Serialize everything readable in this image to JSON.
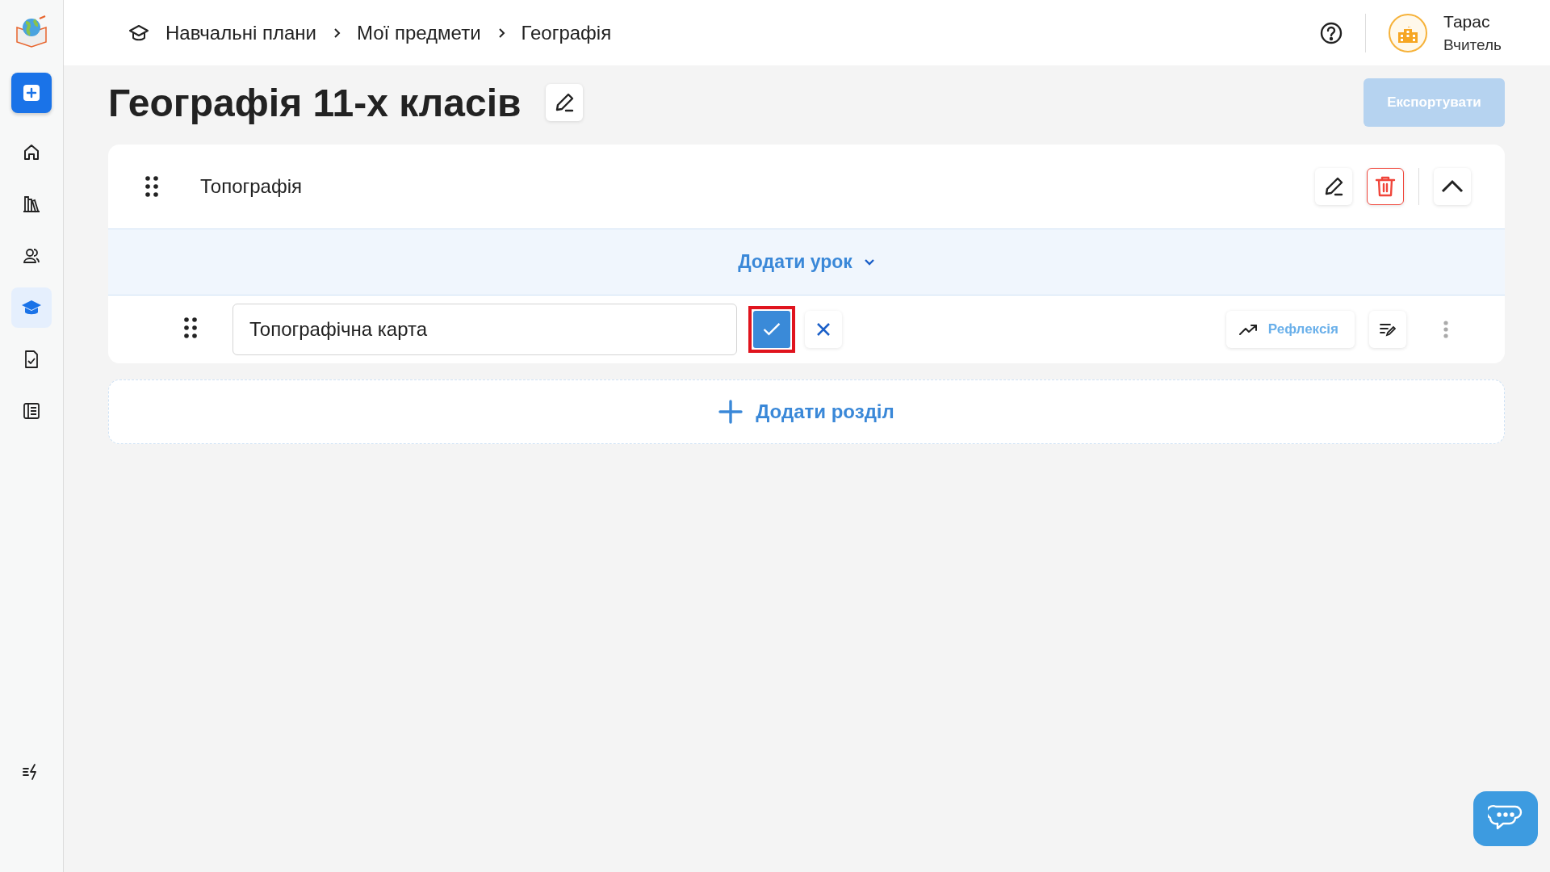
{
  "sidebar": {
    "items": [
      {
        "kind": "add",
        "selected": false
      },
      {
        "kind": "home",
        "selected": false
      },
      {
        "kind": "library",
        "selected": false
      },
      {
        "kind": "people",
        "selected": false
      },
      {
        "kind": "graduation",
        "selected": true
      },
      {
        "kind": "document",
        "selected": false
      },
      {
        "kind": "journal",
        "selected": false
      }
    ]
  },
  "breadcrumb": [
    "Навчальні плани",
    "Мої предмети",
    "Географія"
  ],
  "user": {
    "name": "Тарас",
    "role": "Вчитель"
  },
  "title": "Географія 11-х класів",
  "export_button": {
    "label": "Експортувати",
    "disabled": true
  },
  "section": {
    "title": "Топографія",
    "expanded": true,
    "add_lesson": "Додати урок",
    "lesson": {
      "value": "Топографічна карта",
      "reflection": "Рефлексія"
    }
  },
  "add_section": "Додати розділ"
}
